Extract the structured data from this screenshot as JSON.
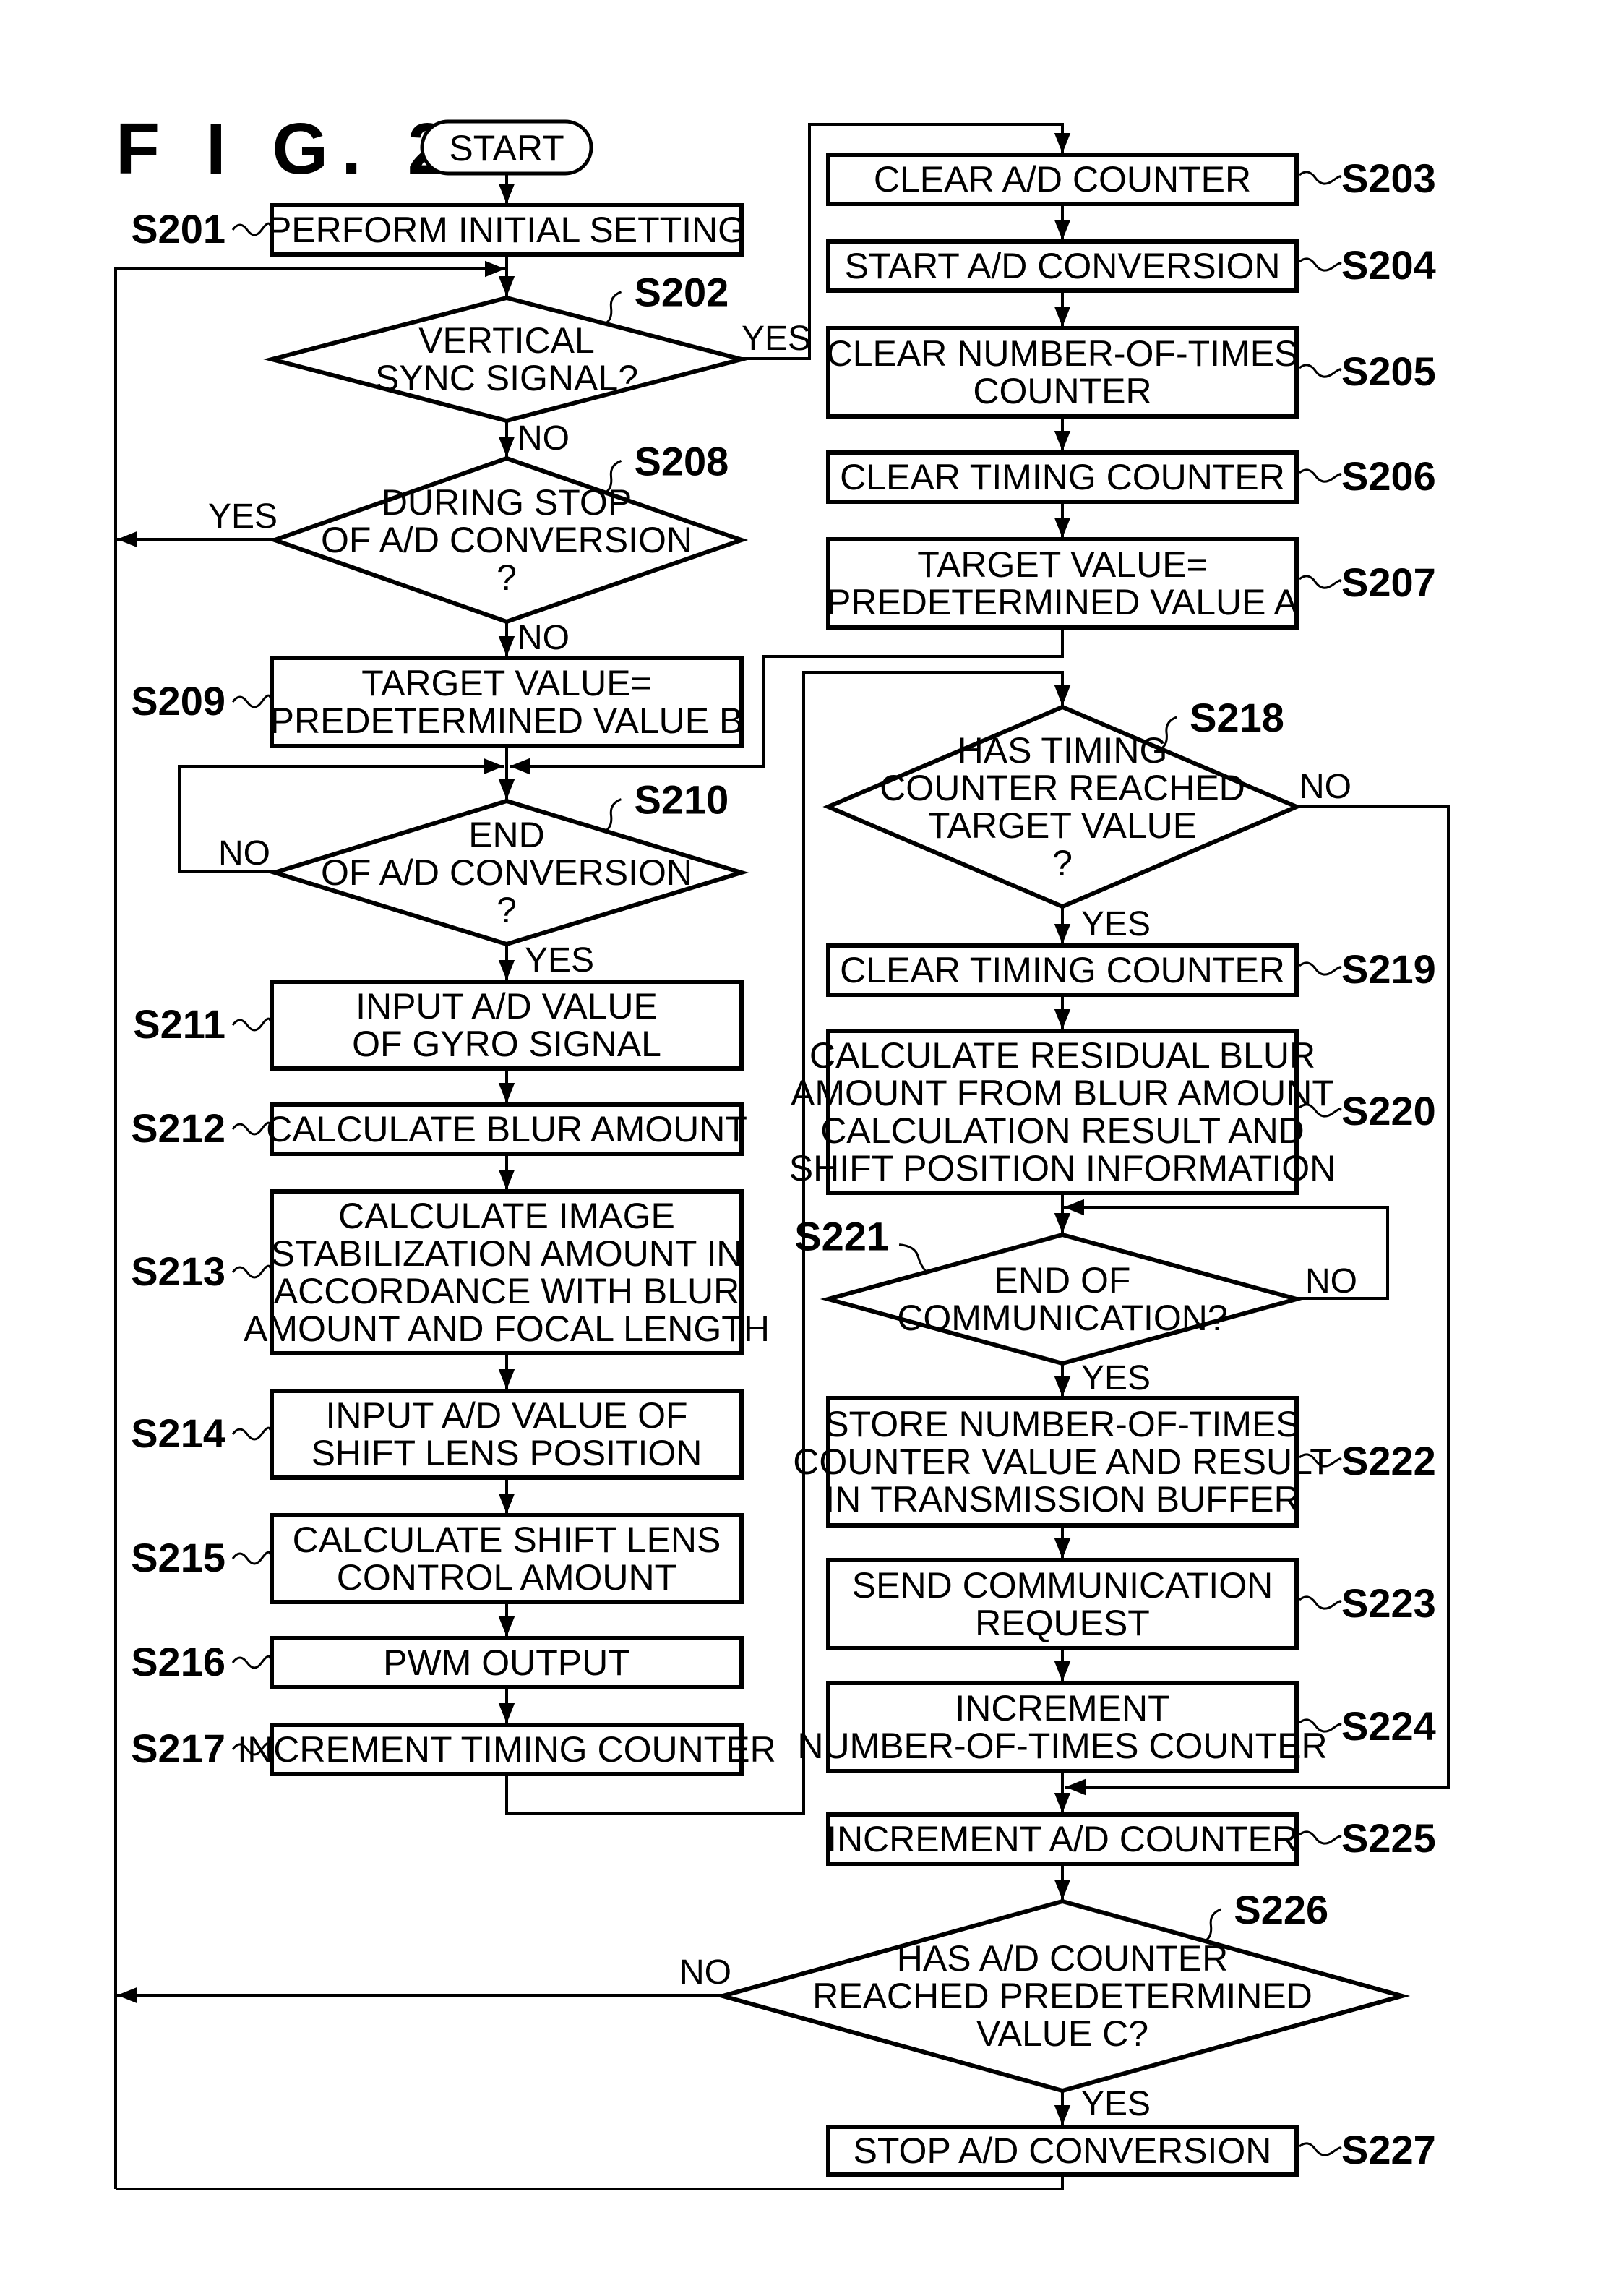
{
  "figure_title": "F I G. 2",
  "start_label": "START",
  "branch_labels": {
    "yes": "YES",
    "no": "NO"
  },
  "steps": {
    "S201": {
      "id": "S201",
      "lines": [
        "PERFORM INITIAL SETTING"
      ]
    },
    "S202": {
      "id": "S202",
      "lines": [
        "VERTICAL",
        "SYNC SIGNAL?"
      ]
    },
    "S203": {
      "id": "S203",
      "lines": [
        "CLEAR A/D COUNTER"
      ]
    },
    "S204": {
      "id": "S204",
      "lines": [
        "START A/D CONVERSION"
      ]
    },
    "S205": {
      "id": "S205",
      "lines": [
        "CLEAR NUMBER-OF-TIMES",
        "COUNTER"
      ]
    },
    "S206": {
      "id": "S206",
      "lines": [
        "CLEAR TIMING COUNTER"
      ]
    },
    "S207": {
      "id": "S207",
      "lines": [
        "TARGET VALUE=",
        "PREDETERMINED VALUE A"
      ]
    },
    "S208": {
      "id": "S208",
      "lines": [
        "DURING STOP",
        "OF A/D CONVERSION",
        "?"
      ]
    },
    "S209": {
      "id": "S209",
      "lines": [
        "TARGET VALUE=",
        "PREDETERMINED VALUE B"
      ]
    },
    "S210": {
      "id": "S210",
      "lines": [
        "END",
        "OF A/D CONVERSION",
        "?"
      ]
    },
    "S211": {
      "id": "S211",
      "lines": [
        "INPUT A/D VALUE",
        "OF GYRO SIGNAL"
      ]
    },
    "S212": {
      "id": "S212",
      "lines": [
        "CALCULATE BLUR AMOUNT"
      ]
    },
    "S213": {
      "id": "S213",
      "lines": [
        "CALCULATE IMAGE",
        "STABILIZATION AMOUNT IN",
        "ACCORDANCE WITH BLUR",
        "AMOUNT AND FOCAL LENGTH"
      ]
    },
    "S214": {
      "id": "S214",
      "lines": [
        "INPUT A/D VALUE OF",
        "SHIFT LENS POSITION"
      ]
    },
    "S215": {
      "id": "S215",
      "lines": [
        "CALCULATE SHIFT LENS",
        "CONTROL AMOUNT"
      ]
    },
    "S216": {
      "id": "S216",
      "lines": [
        "PWM OUTPUT"
      ]
    },
    "S217": {
      "id": "S217",
      "lines": [
        "INCREMENT TIMING COUNTER"
      ]
    },
    "S218": {
      "id": "S218",
      "lines": [
        "HAS TIMING",
        "COUNTER REACHED",
        "TARGET VALUE",
        "?"
      ]
    },
    "S219": {
      "id": "S219",
      "lines": [
        "CLEAR TIMING COUNTER"
      ]
    },
    "S220": {
      "id": "S220",
      "lines": [
        "CALCULATE RESIDUAL BLUR",
        "AMOUNT FROM BLUR AMOUNT",
        "CALCULATION RESULT AND",
        "SHIFT POSITION INFORMATION"
      ]
    },
    "S221": {
      "id": "S221",
      "lines": [
        "END OF",
        "COMMUNICATION?"
      ]
    },
    "S222": {
      "id": "S222",
      "lines": [
        "STORE NUMBER-OF-TIMES",
        "COUNTER VALUE AND RESULT",
        "IN TRANSMISSION BUFFER"
      ]
    },
    "S223": {
      "id": "S223",
      "lines": [
        "SEND COMMUNICATION",
        "REQUEST"
      ]
    },
    "S224": {
      "id": "S224",
      "lines": [
        "INCREMENT",
        "NUMBER-OF-TIMES COUNTER"
      ]
    },
    "S225": {
      "id": "S225",
      "lines": [
        "INCREMENT A/D COUNTER"
      ]
    },
    "S226": {
      "id": "S226",
      "lines": [
        "HAS A/D COUNTER",
        "REACHED PREDETERMINED",
        "VALUE C?"
      ]
    },
    "S227": {
      "id": "S227",
      "lines": [
        "STOP A/D CONVERSION"
      ]
    }
  }
}
